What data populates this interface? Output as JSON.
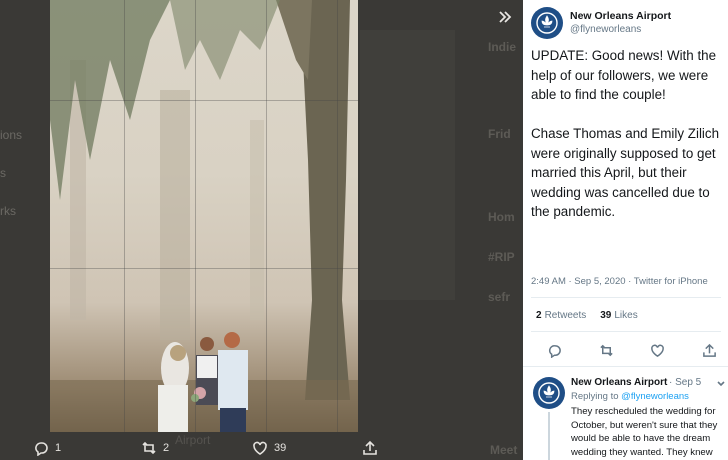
{
  "background": {
    "sidebar_fragments": [
      "ions",
      "s",
      "rks"
    ],
    "right_fragments": [
      "Indie",
      "Frid",
      "Hom",
      "#RIP",
      "sefr"
    ],
    "bottom_author": "Airport",
    "bottom_right": "Meet"
  },
  "image_toolbar": {
    "replies": "1",
    "retweets": "2",
    "likes": "39"
  },
  "tweet": {
    "name": "New Orleans Airport",
    "handle": "@flyneworleans",
    "text": "UPDATE: Good news! With the help of our followers, we were able to find the couple!\n\nChase Thomas and Emily Zilich were originally supposed to get married this April, but their wedding was cancelled due to the pandemic.",
    "meta": "2:49 AM · Sep 5, 2020 · Twitter for iPhone",
    "retweet_count": "2",
    "retweet_label": "Retweets",
    "like_count": "39",
    "like_label": "Likes"
  },
  "reply": {
    "name": "New Orleans Airport",
    "meta": "· Sep 5",
    "replying_prefix": "Replying to",
    "replying_handle": "@flyneworleans",
    "text": "They rescheduled the wedding for October, but weren't sure that they would be able to have the dream wedding they wanted. They knew"
  },
  "colors": {
    "brand": "#1f4e86",
    "link": "#1da1f2",
    "overlay": "#353432"
  }
}
